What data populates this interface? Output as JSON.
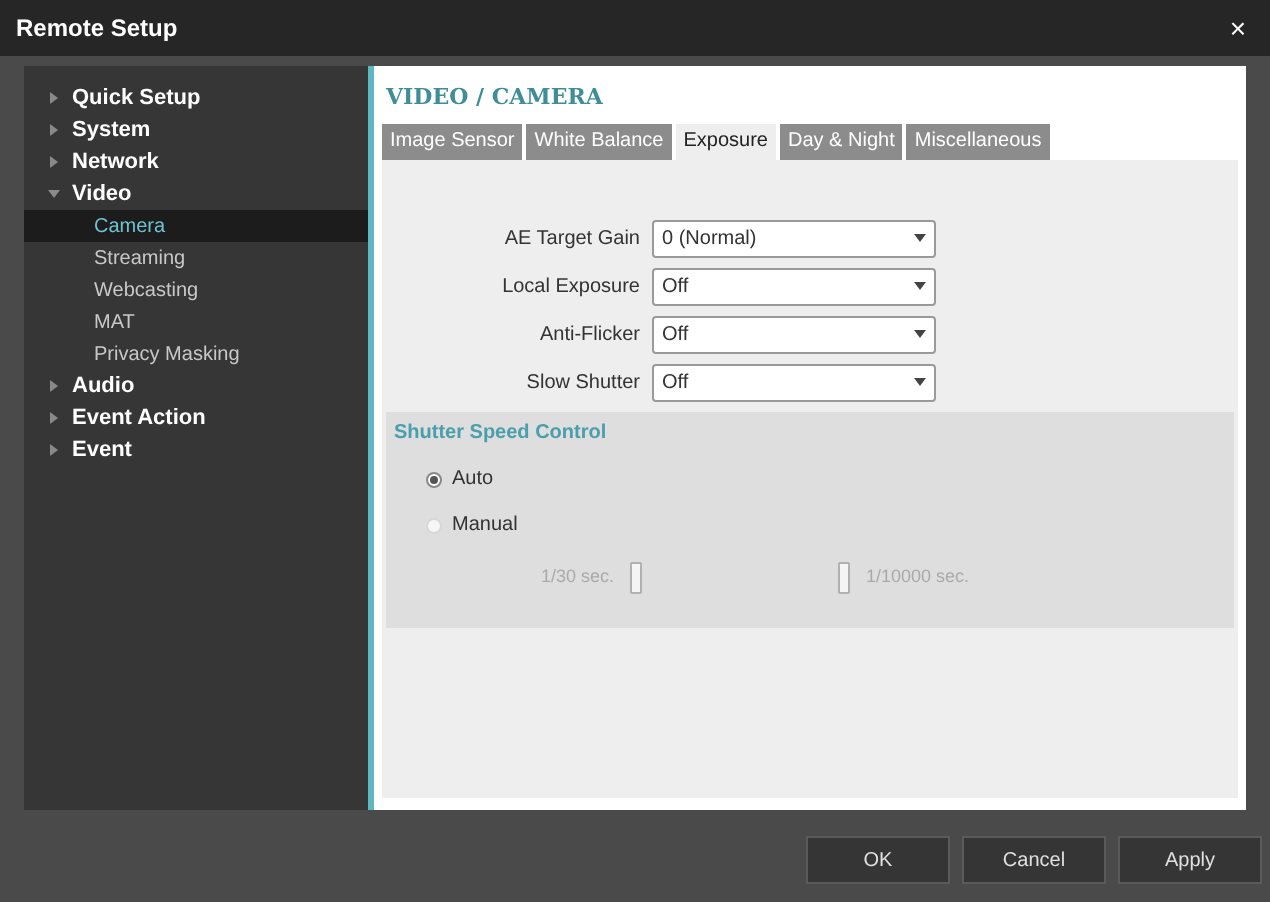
{
  "window": {
    "title": "Remote Setup",
    "close": "×"
  },
  "sidebar": {
    "items": [
      {
        "label": "Quick Setup",
        "expanded": false
      },
      {
        "label": "System",
        "expanded": false
      },
      {
        "label": "Network",
        "expanded": false
      },
      {
        "label": "Video",
        "expanded": true,
        "children": [
          {
            "label": "Camera",
            "selected": true
          },
          {
            "label": "Streaming",
            "selected": false
          },
          {
            "label": "Webcasting",
            "selected": false
          },
          {
            "label": "MAT",
            "selected": false
          },
          {
            "label": "Privacy Masking",
            "selected": false
          }
        ]
      },
      {
        "label": "Audio",
        "expanded": false
      },
      {
        "label": "Event Action",
        "expanded": false
      },
      {
        "label": "Event",
        "expanded": false
      }
    ]
  },
  "panel": {
    "title": "VIDEO / CAMERA",
    "tabs": [
      {
        "label": "Image Sensor",
        "selected": false
      },
      {
        "label": "White Balance",
        "selected": false
      },
      {
        "label": "Exposure",
        "selected": true
      },
      {
        "label": "Day & Night",
        "selected": false
      },
      {
        "label": "Miscellaneous",
        "selected": false
      }
    ],
    "fields": [
      {
        "label": "AE Target Gain",
        "value": "0 (Normal)"
      },
      {
        "label": "Local Exposure",
        "value": "Off"
      },
      {
        "label": "Anti-Flicker",
        "value": "Off"
      },
      {
        "label": "Slow Shutter",
        "value": "Off"
      }
    ],
    "shutter": {
      "title": "Shutter Speed Control",
      "options": [
        {
          "label": "Auto",
          "selected": true
        },
        {
          "label": "Manual",
          "selected": false
        }
      ],
      "slider": {
        "disabled": true,
        "min_label": "1/30 sec.",
        "max_label": "1/10000 sec.",
        "thumbs": [
          {
            "level": 0
          },
          {
            "level": 1
          }
        ]
      }
    }
  },
  "buttons": [
    "OK",
    "Cancel",
    "Apply"
  ]
}
